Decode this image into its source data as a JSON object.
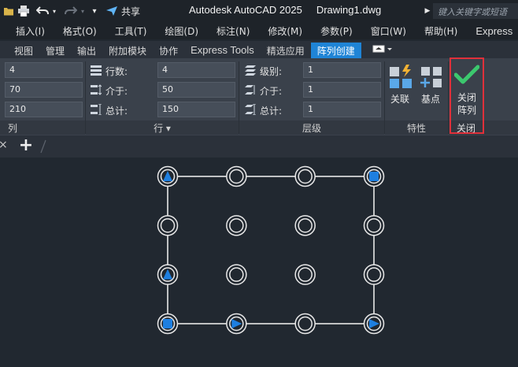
{
  "app": {
    "title": "Autodesk AutoCAD 2025",
    "document": "Drawing1.dwg",
    "share_label": "共享",
    "search_placeholder": "键入关键字或短语"
  },
  "menu": [
    "插入(I)",
    "格式(O)",
    "工具(T)",
    "绘图(D)",
    "标注(N)",
    "修改(M)",
    "参数(P)",
    "窗口(W)",
    "帮助(H)",
    "Express"
  ],
  "tabs": [
    {
      "label": "视图",
      "active": false
    },
    {
      "label": "管理",
      "active": false
    },
    {
      "label": "输出",
      "active": false
    },
    {
      "label": "附加模块",
      "active": false
    },
    {
      "label": "协作",
      "active": false
    },
    {
      "label": "Express Tools",
      "active": false
    },
    {
      "label": "精选应用",
      "active": false
    },
    {
      "label": "阵列创建",
      "active": true
    }
  ],
  "columns_panel": {
    "values": [
      "4",
      "70",
      "210"
    ],
    "footer": "列"
  },
  "rows_panel": {
    "labels": [
      "行数:",
      "介于:",
      "总计:"
    ],
    "values": [
      "4",
      "50",
      "150"
    ],
    "footer": "行 ▾"
  },
  "levels_panel": {
    "labels": [
      "级别:",
      "介于:",
      "总计:"
    ],
    "values": [
      "1",
      "1",
      "1"
    ],
    "footer": "层级"
  },
  "properties_panel": {
    "associative_label": "关联",
    "basepoint_label": "基点",
    "footer": "特性"
  },
  "close_panel": {
    "line1": "关闭",
    "line2": "阵列",
    "footer": "关闭"
  },
  "doc_tab": {
    "new_tab_symbol": "+"
  },
  "colors": {
    "accent": "#1f84d6",
    "check": "#3cc86e",
    "highlight_border": "#e0303a",
    "grip": "#1e7fe0"
  },
  "array": {
    "columns": 4,
    "rows": 4
  }
}
